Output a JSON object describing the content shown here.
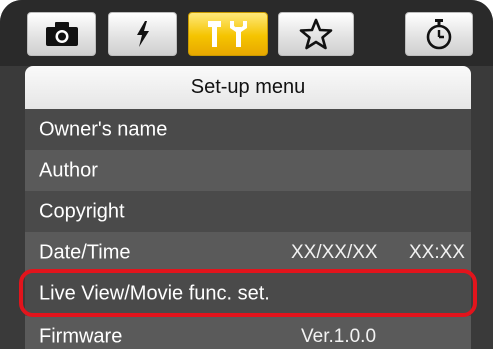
{
  "tabs": [
    {
      "icon": "camera-icon",
      "active": false
    },
    {
      "icon": "flash-bolt-icon",
      "active": false
    },
    {
      "icon": "wrench-tools-icon",
      "active": true
    },
    {
      "icon": "star-icon",
      "active": false
    },
    {
      "icon": "stopwatch-icon",
      "active": false
    }
  ],
  "panel": {
    "title": "Set-up menu"
  },
  "menu": {
    "items": [
      {
        "label": "Owner's name",
        "value": ""
      },
      {
        "label": "Author",
        "value": ""
      },
      {
        "label": "Copyright",
        "value": ""
      },
      {
        "label": "Date/Time",
        "value": "XX/XX/XX",
        "value2": "XX:XX"
      },
      {
        "label": "Live View/Movie func. set.",
        "value": ""
      },
      {
        "label": "Firmware",
        "value": "Ver.1.0.0"
      }
    ],
    "highlighted_index": 4
  },
  "colors": {
    "active_tab": "#f5c400",
    "highlight_border": "#e2141c",
    "screen_background": "#3a3a3a"
  }
}
